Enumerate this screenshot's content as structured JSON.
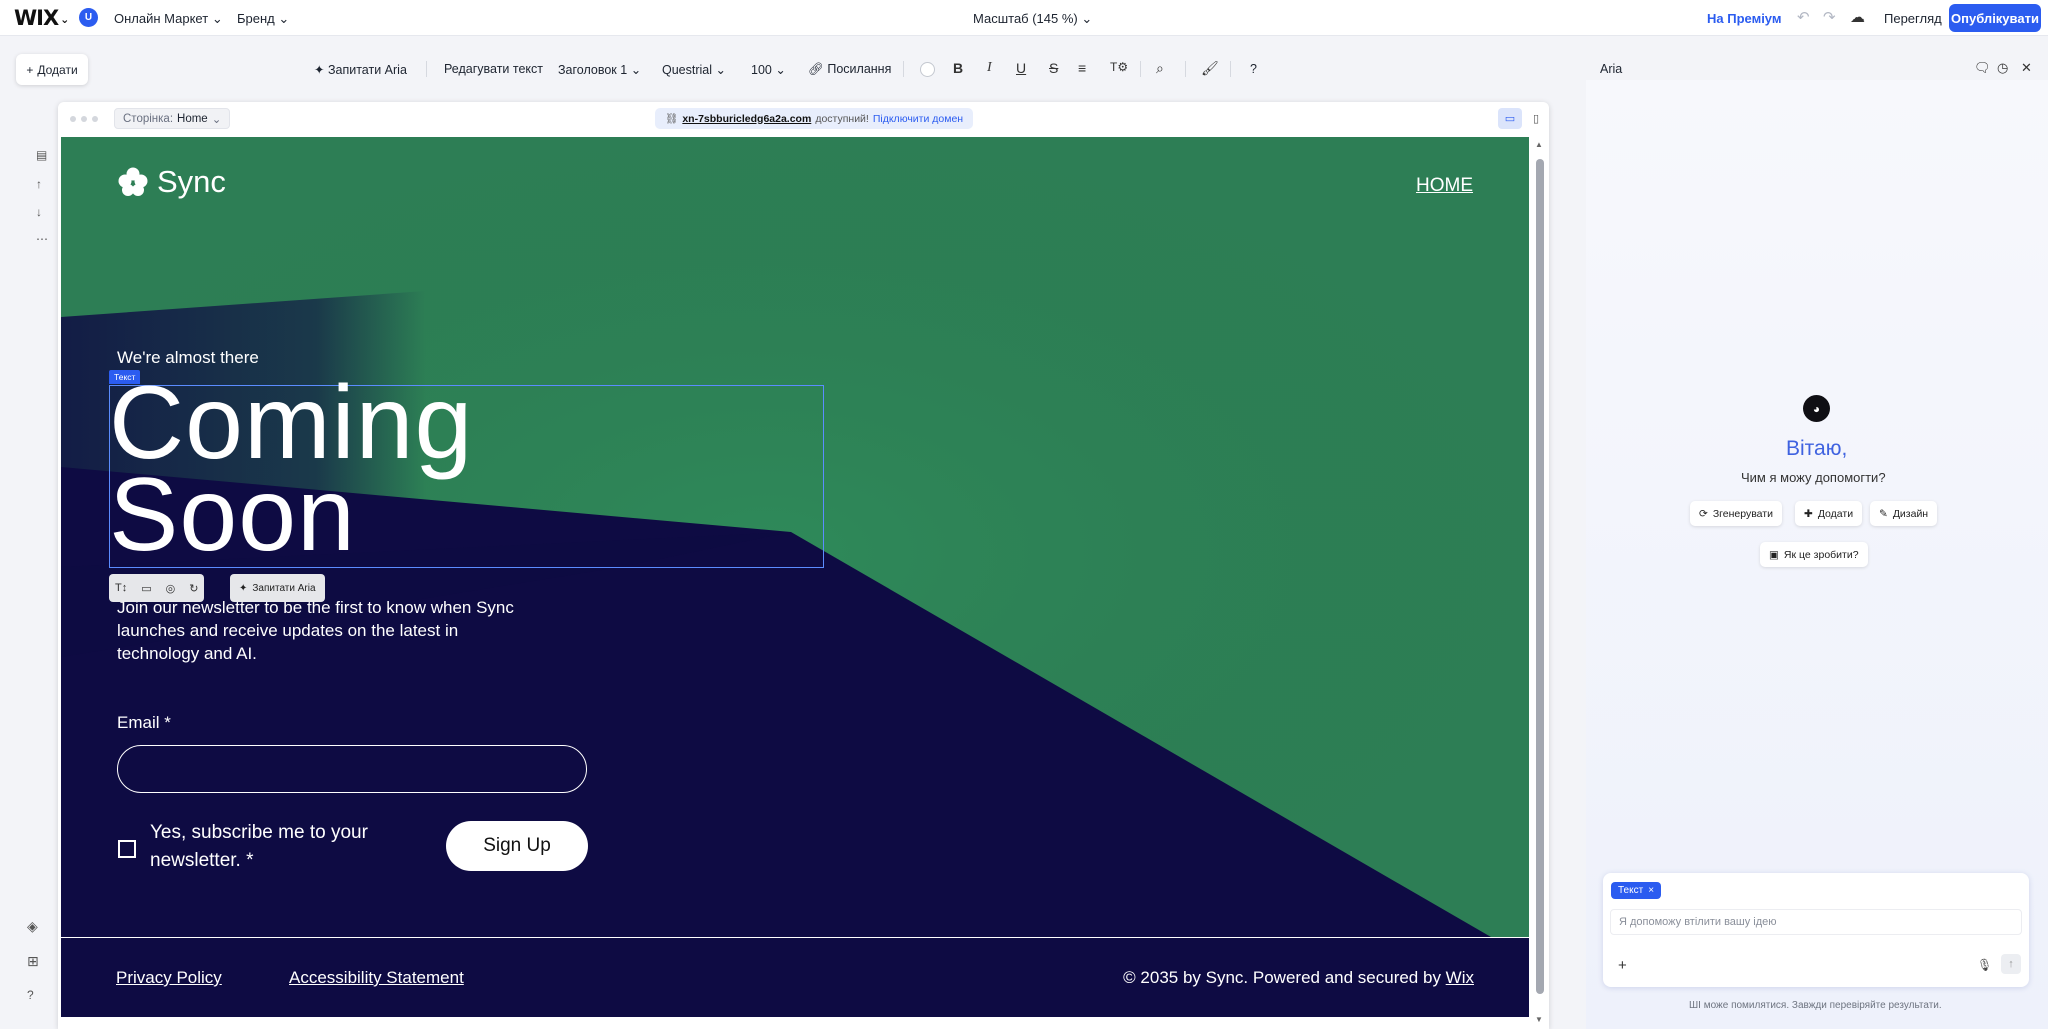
{
  "topbar": {
    "logo": "WIX",
    "user_initial": "U",
    "menu_market": "Онлайн Маркет",
    "menu_brand": "Бренд",
    "zoom": "Масштаб (145 %)",
    "premium": "На Преміум",
    "preview": "Перегляд",
    "publish": "Опублікувати"
  },
  "toolbar": {
    "add": "Додати",
    "ask_aria": "Запитати Aria",
    "edit_text": "Редагувати текст",
    "heading": "Заголовок 1",
    "font": "Questrial",
    "size": "100",
    "link": "Посилання",
    "help": "?",
    "panel_title": "Aria"
  },
  "frame": {
    "page_label": "Сторінка:",
    "page_name": "Home",
    "domain": "xn-7sbburicledg6a2a.com",
    "domain_status": "доступний!",
    "connect_domain": "Підключити домен"
  },
  "site": {
    "logo_text": "Sync",
    "nav_home": "HOME",
    "eyebrow": "We're almost there",
    "selection_tag": "Текст",
    "headline_line1": "Coming",
    "headline_line2": "Soon",
    "ask_aria_mini": "Запитати Aria",
    "blurb": "Join our newsletter to be the first to know when Sync launches and receive updates on the latest in technology and AI.",
    "email_label": "Email *",
    "subscribe_text": "Yes, subscribe me to your newsletter. *",
    "signup": "Sign Up",
    "footer_privacy": "Privacy Policy",
    "footer_accessibility": "Accessibility Statement",
    "footer_copy": "© 2035 by Sync. Powered and secured by ",
    "footer_wix": "Wix"
  },
  "aria": {
    "hello": "Вітаю,",
    "sub": "Чим я можу допомогти?",
    "chip_generate": "Згенерувати",
    "chip_add": "Додати",
    "chip_design": "Дизайн",
    "chip_howto": "Як це зробити?",
    "text_chip": "Текст",
    "placeholder": "Я допоможу втілити вашу ідею",
    "disclaimer": "ШІ може помилятися. Завжди перевіряйте результати."
  },
  "colors": {
    "accent": "#2b5cf0",
    "hero_green": "#2e7d53",
    "hero_navy": "#0e0b43"
  }
}
